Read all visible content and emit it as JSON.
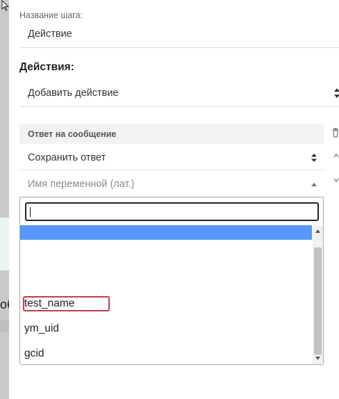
{
  "step": {
    "name_label": "Название шага:",
    "name_value": "Действие"
  },
  "actions": {
    "title": "Действия:",
    "add_action_label": "Добавить действие"
  },
  "reply": {
    "header": "Ответ на сообщение",
    "save_select_value": "Сохранить ответ",
    "variable_placeholder": "Имя переменной (лат.)"
  },
  "dropdown": {
    "search_value": "",
    "options": [
      {
        "label": "",
        "highlighted": true
      },
      {
        "label": ""
      },
      {
        "label": ""
      },
      {
        "label": "test_name",
        "marked": true
      },
      {
        "label": "ym_uid"
      },
      {
        "label": "gcid"
      }
    ]
  },
  "background": {
    "obscured_text": "об"
  },
  "colors": {
    "highlight": "#5897fb",
    "marker_border": "#c43a4a"
  }
}
